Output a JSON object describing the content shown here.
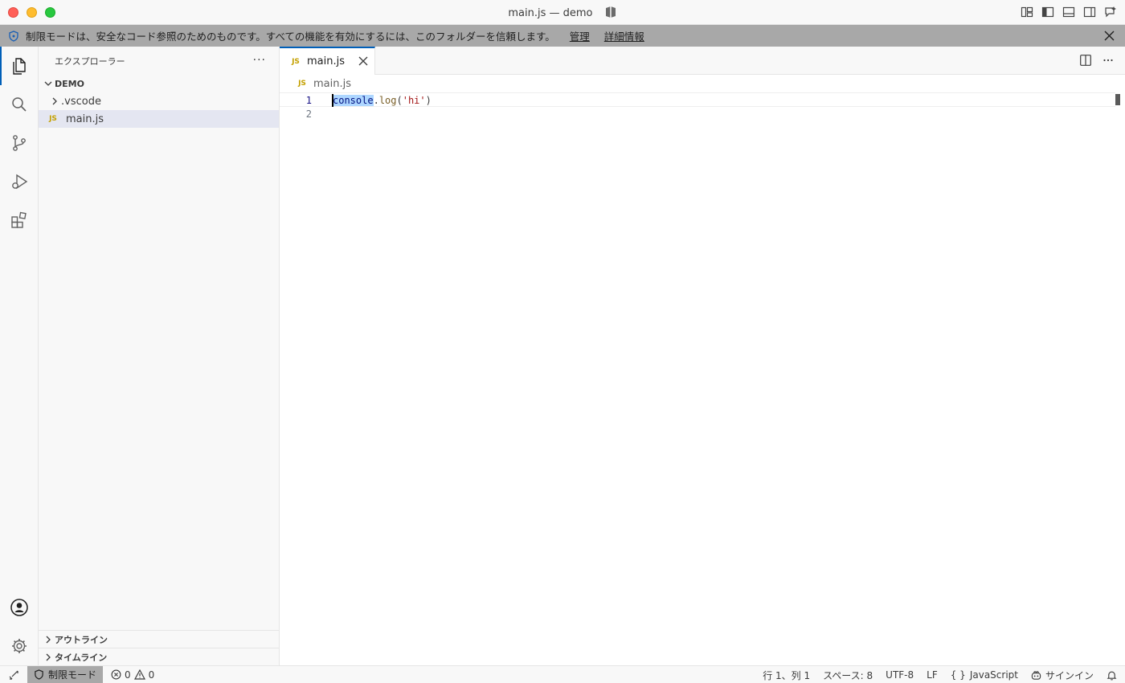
{
  "window": {
    "title": "main.js — demo"
  },
  "banner": {
    "message": "制限モードは、安全なコード参照のためのものです。すべての機能を有効にするには、このフォルダーを信頼します。",
    "manage_label": "管理",
    "details_label": "詳細情報"
  },
  "sidebar": {
    "title": "エクスプローラー",
    "more": "···",
    "root_folder": "DEMO",
    "items": [
      {
        "label": ".vscode",
        "kind": "folder"
      },
      {
        "label": "main.js",
        "kind": "file",
        "badge": "JS"
      }
    ],
    "outline_label": "アウトライン",
    "timeline_label": "タイムライン"
  },
  "editor": {
    "tab": {
      "label": "main.js",
      "badge": "JS"
    },
    "breadcrumb": {
      "label": "main.js",
      "badge": "JS"
    },
    "lines": [
      {
        "number": "1",
        "tokens": [
          "console",
          ".",
          "log",
          "(",
          "'hi'",
          ")"
        ]
      },
      {
        "number": "2",
        "tokens": []
      }
    ]
  },
  "statusbar": {
    "restricted_label": "制限モード",
    "errors": "0",
    "warnings": "0",
    "position": "行 1、列 1",
    "spaces": "スペース: 8",
    "encoding": "UTF-8",
    "eol": "LF",
    "language_braces": "{ }",
    "language": "JavaScript",
    "signin": "サインイン"
  },
  "colors": {
    "accent": "#005fb8",
    "banner_bg": "#a8a8a8",
    "js_badge": "#c4a000"
  }
}
